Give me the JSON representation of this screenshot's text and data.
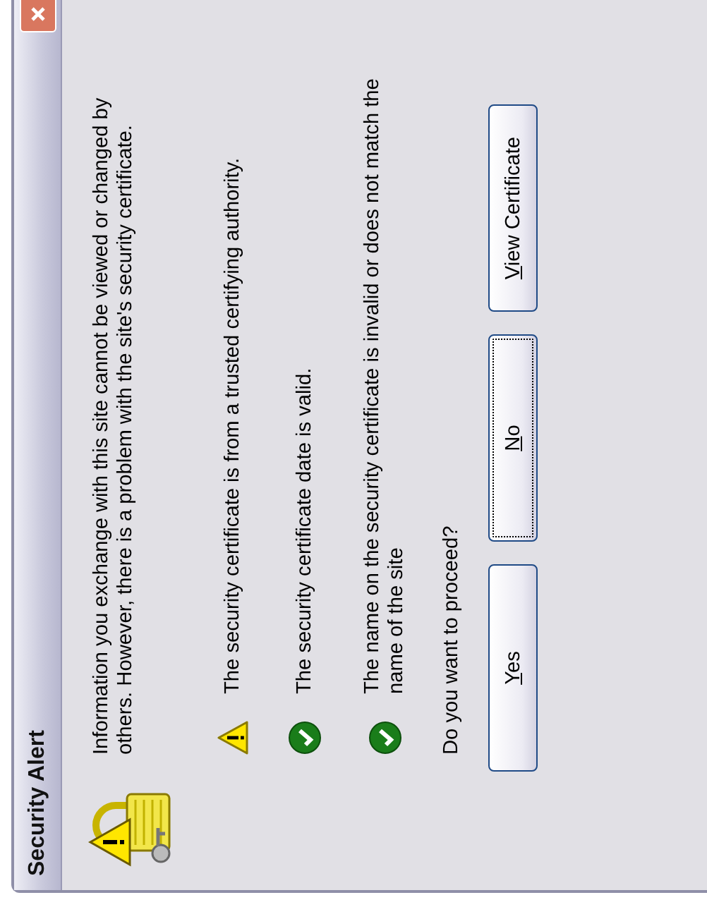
{
  "window": {
    "title": "Security Alert"
  },
  "message": "Information you exchange with this site cannot be viewed or changed by others. However, there is a problem with the site's security certificate.",
  "checks": [
    {
      "kind": "warning",
      "text": "The security certificate is from a trusted certifying authority."
    },
    {
      "kind": "ok",
      "text": "The security certificate date is valid."
    },
    {
      "kind": "ok",
      "text": "The name on the security certificate is invalid or does not match the name of the site"
    }
  ],
  "question": "Do you want to proceed?",
  "buttons": [
    {
      "access_key": "Y",
      "rest": "es",
      "focused": false
    },
    {
      "access_key": "N",
      "rest": "o",
      "focused": true
    },
    {
      "access_key": "V",
      "rest": "iew Certificate",
      "focused": false
    }
  ]
}
